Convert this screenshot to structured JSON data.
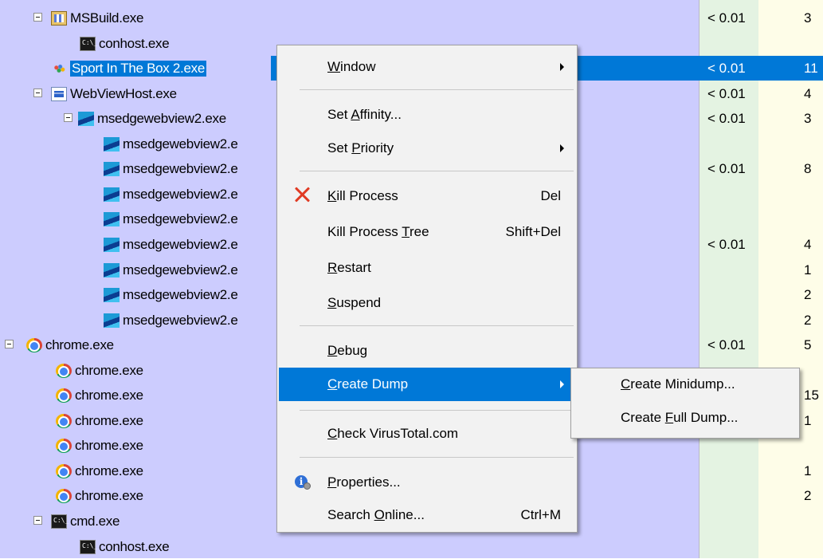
{
  "process_tree": [
    {
      "name": "MSBuild.exe",
      "icon": "msbuild-icon",
      "cpu": "< 0.01",
      "mem": "3",
      "depth": 1,
      "expandable": true
    },
    {
      "name": "conhost.exe",
      "icon": "console-icon",
      "cpu": "",
      "mem": "",
      "depth": 2,
      "expandable": false
    },
    {
      "name": "Sport In The Box 2.exe",
      "icon": "sport-app-icon",
      "cpu": "< 0.01",
      "mem": "11",
      "depth": 1,
      "expandable": false,
      "selected": true
    },
    {
      "name": "WebViewHost.exe",
      "icon": "window-app-icon",
      "cpu": "< 0.01",
      "mem": "4",
      "depth": 1,
      "expandable": true
    },
    {
      "name": "msedgewebview2.exe",
      "icon": "edge-webview-icon",
      "cpu": "< 0.01",
      "mem": "3",
      "depth": 2,
      "expandable": true
    },
    {
      "name": "msedgewebview2.e",
      "icon": "edge-webview-icon",
      "cpu": "",
      "mem": "",
      "depth": 3
    },
    {
      "name": "msedgewebview2.e",
      "icon": "edge-webview-icon",
      "cpu": "< 0.01",
      "mem": "8",
      "depth": 3
    },
    {
      "name": "msedgewebview2.e",
      "icon": "edge-webview-icon",
      "cpu": "",
      "mem": "",
      "depth": 3
    },
    {
      "name": "msedgewebview2.e",
      "icon": "edge-webview-icon",
      "cpu": "",
      "mem": "",
      "depth": 3
    },
    {
      "name": "msedgewebview2.e",
      "icon": "edge-webview-icon",
      "cpu": "< 0.01",
      "mem": "4",
      "depth": 3
    },
    {
      "name": "msedgewebview2.e",
      "icon": "edge-webview-icon",
      "cpu": "",
      "mem": "1",
      "depth": 3
    },
    {
      "name": "msedgewebview2.e",
      "icon": "edge-webview-icon",
      "cpu": "",
      "mem": "2",
      "depth": 3
    },
    {
      "name": "msedgewebview2.e",
      "icon": "edge-webview-icon",
      "cpu": "",
      "mem": "2",
      "depth": 3
    },
    {
      "name": "chrome.exe",
      "icon": "chrome-icon",
      "cpu": "< 0.01",
      "mem": "5",
      "depth": 0,
      "expandable": true
    },
    {
      "name": "chrome.exe",
      "icon": "chrome-icon",
      "cpu": "",
      "mem": "",
      "depth": 1
    },
    {
      "name": "chrome.exe",
      "icon": "chrome-icon",
      "cpu": "",
      "mem": "15",
      "depth": 1
    },
    {
      "name": "chrome.exe",
      "icon": "chrome-icon",
      "cpu": "",
      "mem": "1",
      "depth": 1
    },
    {
      "name": "chrome.exe",
      "icon": "chrome-icon",
      "cpu": "",
      "mem": "",
      "depth": 1
    },
    {
      "name": "chrome.exe",
      "icon": "chrome-icon",
      "cpu": "",
      "mem": "1",
      "depth": 1
    },
    {
      "name": "chrome.exe",
      "icon": "chrome-icon",
      "cpu": "",
      "mem": "2",
      "depth": 1
    },
    {
      "name": "cmd.exe",
      "icon": "console-icon",
      "cpu": "",
      "mem": "",
      "depth": 1,
      "expandable": true
    },
    {
      "name": "conhost.exe",
      "icon": "console-icon",
      "cpu": "",
      "mem": "",
      "depth": 2
    }
  ],
  "context_menu": {
    "window": {
      "pre": "",
      "key": "W",
      "post": "indow"
    },
    "set_affinity": {
      "pre": "Set ",
      "key": "A",
      "post": "ffinity..."
    },
    "set_priority": {
      "pre": "Set ",
      "key": "P",
      "post": "riority"
    },
    "kill_process": {
      "pre": "",
      "key": "K",
      "post": "ill Process",
      "shortcut": "Del"
    },
    "kill_process_tree": {
      "pre": "Kill Process ",
      "key": "T",
      "post": "ree",
      "shortcut": "Shift+Del"
    },
    "restart": {
      "pre": "",
      "key": "R",
      "post": "estart"
    },
    "suspend": {
      "pre": "",
      "key": "S",
      "post": "uspend"
    },
    "debug": {
      "pre": "",
      "key": "D",
      "post": "ebug"
    },
    "create_dump": {
      "pre": "",
      "key": "C",
      "post": "reate Dump"
    },
    "check_virustotal": {
      "pre": "",
      "key": "C",
      "post": "heck VirusTotal.com"
    },
    "properties": {
      "pre": "",
      "key": "P",
      "post": "roperties..."
    },
    "search_online": {
      "pre": "Search ",
      "key": "O",
      "post": "nline...",
      "shortcut": "Ctrl+M"
    }
  },
  "submenu": {
    "create_minidump": {
      "pre": "",
      "key": "C",
      "post": "reate Minidump..."
    },
    "create_full_dump": {
      "pre": "Create ",
      "key": "F",
      "post": "ull Dump..."
    }
  },
  "colors": {
    "tree_background": "#ccccfe",
    "cpu_column": "#e4f3e2",
    "memory_column": "#fefde8",
    "selection": "#0078d7",
    "menu_background": "#f2f2f2",
    "kill_x": "#e03b24"
  }
}
